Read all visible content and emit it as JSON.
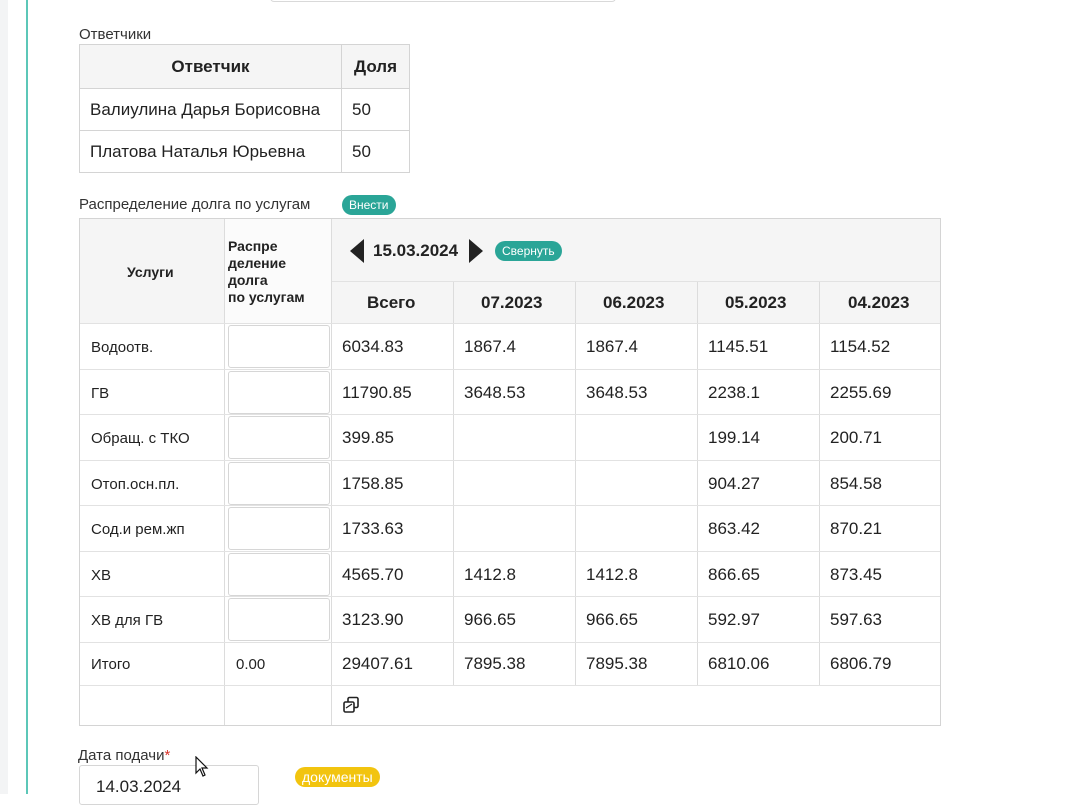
{
  "respondents": {
    "section_label": "Ответчики",
    "headers": {
      "respondent": "Ответчик",
      "share": "Доля"
    },
    "rows": [
      {
        "name": "Валиулина Дарья Борисовна",
        "share": "50"
      },
      {
        "name": "Платова Наталья Юрьевна",
        "share": "50"
      }
    ]
  },
  "distribution": {
    "section_label": "Распределение долга по услугам",
    "apply_button": "Внести",
    "services_header": "Услуги",
    "allocation_header": [
      "Распре",
      "деление",
      "долга",
      "по услугам"
    ],
    "current_date": "15.03.2024",
    "collapse_button": "Свернуть",
    "columns": [
      "Всего",
      "07.2023",
      "06.2023",
      "05.2023",
      "04.2023"
    ],
    "rows": [
      {
        "service": "Водоотв.",
        "values": [
          "6034.83",
          "1867.4",
          "1867.4",
          "1145.51",
          "1154.52"
        ]
      },
      {
        "service": "ГВ",
        "values": [
          "11790.85",
          "3648.53",
          "3648.53",
          "2238.1",
          "2255.69"
        ]
      },
      {
        "service": "Обращ. с ТКО",
        "values": [
          "399.85",
          "",
          "",
          "199.14",
          "200.71"
        ]
      },
      {
        "service": "Отоп.осн.пл.",
        "values": [
          "1758.85",
          "",
          "",
          "904.27",
          "854.58"
        ]
      },
      {
        "service": "Сод.и рем.жп",
        "values": [
          "1733.63",
          "",
          "",
          "863.42",
          "870.21"
        ]
      },
      {
        "service": "ХВ",
        "values": [
          "4565.70",
          "1412.8",
          "1412.8",
          "866.65",
          "873.45"
        ]
      },
      {
        "service": "ХВ для ГВ",
        "values": [
          "3123.90",
          "966.65",
          "966.65",
          "592.97",
          "597.63"
        ]
      }
    ],
    "total": {
      "label": "Итого",
      "allocation": "0.00",
      "values": [
        "29407.61",
        "7895.38",
        "7895.38",
        "6810.06",
        "6806.79"
      ]
    },
    "copy_icon": "copy-icon"
  },
  "submission": {
    "date_label": "Дата подачи",
    "required_mark": "*",
    "date_value": "14.03.2024",
    "documents_button": "документы"
  },
  "colors": {
    "accent_teal": "#2aa597",
    "documents_yellow": "#f2c40f",
    "rail": "#5cc7b8"
  }
}
